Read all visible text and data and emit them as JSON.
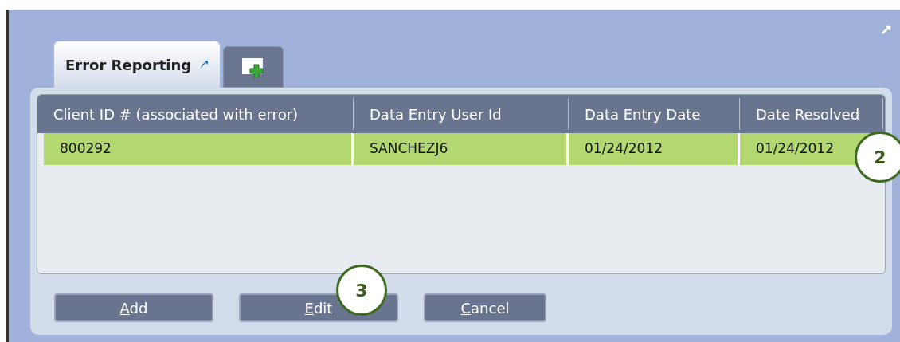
{
  "tabs": [
    {
      "label": "Error Reporting",
      "selected": true,
      "kind": "text"
    },
    {
      "kind": "add",
      "selected": false
    }
  ],
  "table": {
    "columns": [
      "Client ID # (associated with error)",
      "Data Entry User Id",
      "Data Entry Date",
      "Date Resolved"
    ],
    "rows": [
      {
        "selected": true,
        "cells": [
          "800292",
          "SANCHEZJ6",
          "01/24/2012",
          "01/24/2012"
        ]
      }
    ]
  },
  "buttons": [
    "Add",
    "Edit",
    "Cancel"
  ],
  "callouts": [
    {
      "label": "2"
    },
    {
      "label": "3"
    }
  ]
}
